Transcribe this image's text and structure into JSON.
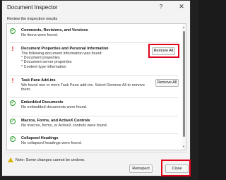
{
  "window": {
    "title": "Document Inspector",
    "help": "?",
    "close_glyph": "✕"
  },
  "subtitle": "Review the inspection results",
  "items": [
    {
      "status": "ok",
      "title": "Comments, Revisions, and Versions",
      "lines": [
        "No items were found."
      ]
    },
    {
      "status": "warn",
      "title": "Document Properties and Personal Information",
      "lines": [
        "The following document information was found:",
        "* Document properties",
        "* Document server properties",
        "* Content type information"
      ],
      "button": "Remove All"
    },
    {
      "status": "warn",
      "title": "Task Pane Add-ins",
      "lines": [
        "We found one or more Task Pane add-ins. Select Remove All to remove",
        "them."
      ],
      "button": "Remove All"
    },
    {
      "status": "ok",
      "title": "Embedded Documents",
      "lines": [
        "No embedded documents were found."
      ]
    },
    {
      "status": "ok",
      "title": "Macros, Forms, and ActiveX Controls",
      "lines": [
        "No macros, forms, or ActiveX controls were found."
      ]
    },
    {
      "status": "ok",
      "title": "Collapsed Headings",
      "lines": [
        "No collapsed headings were found."
      ]
    }
  ],
  "note": "Note: Some changes cannot be undone.",
  "buttons": {
    "reinspect": "Reinspect",
    "close": "Close"
  },
  "icons": {
    "ok": "check-circle-icon",
    "warn": "exclamation-icon",
    "note": "warning-triangle-icon"
  },
  "colors": {
    "highlight": "#e0001b",
    "ok": "#2f9f2f",
    "warn": "#d80000"
  }
}
